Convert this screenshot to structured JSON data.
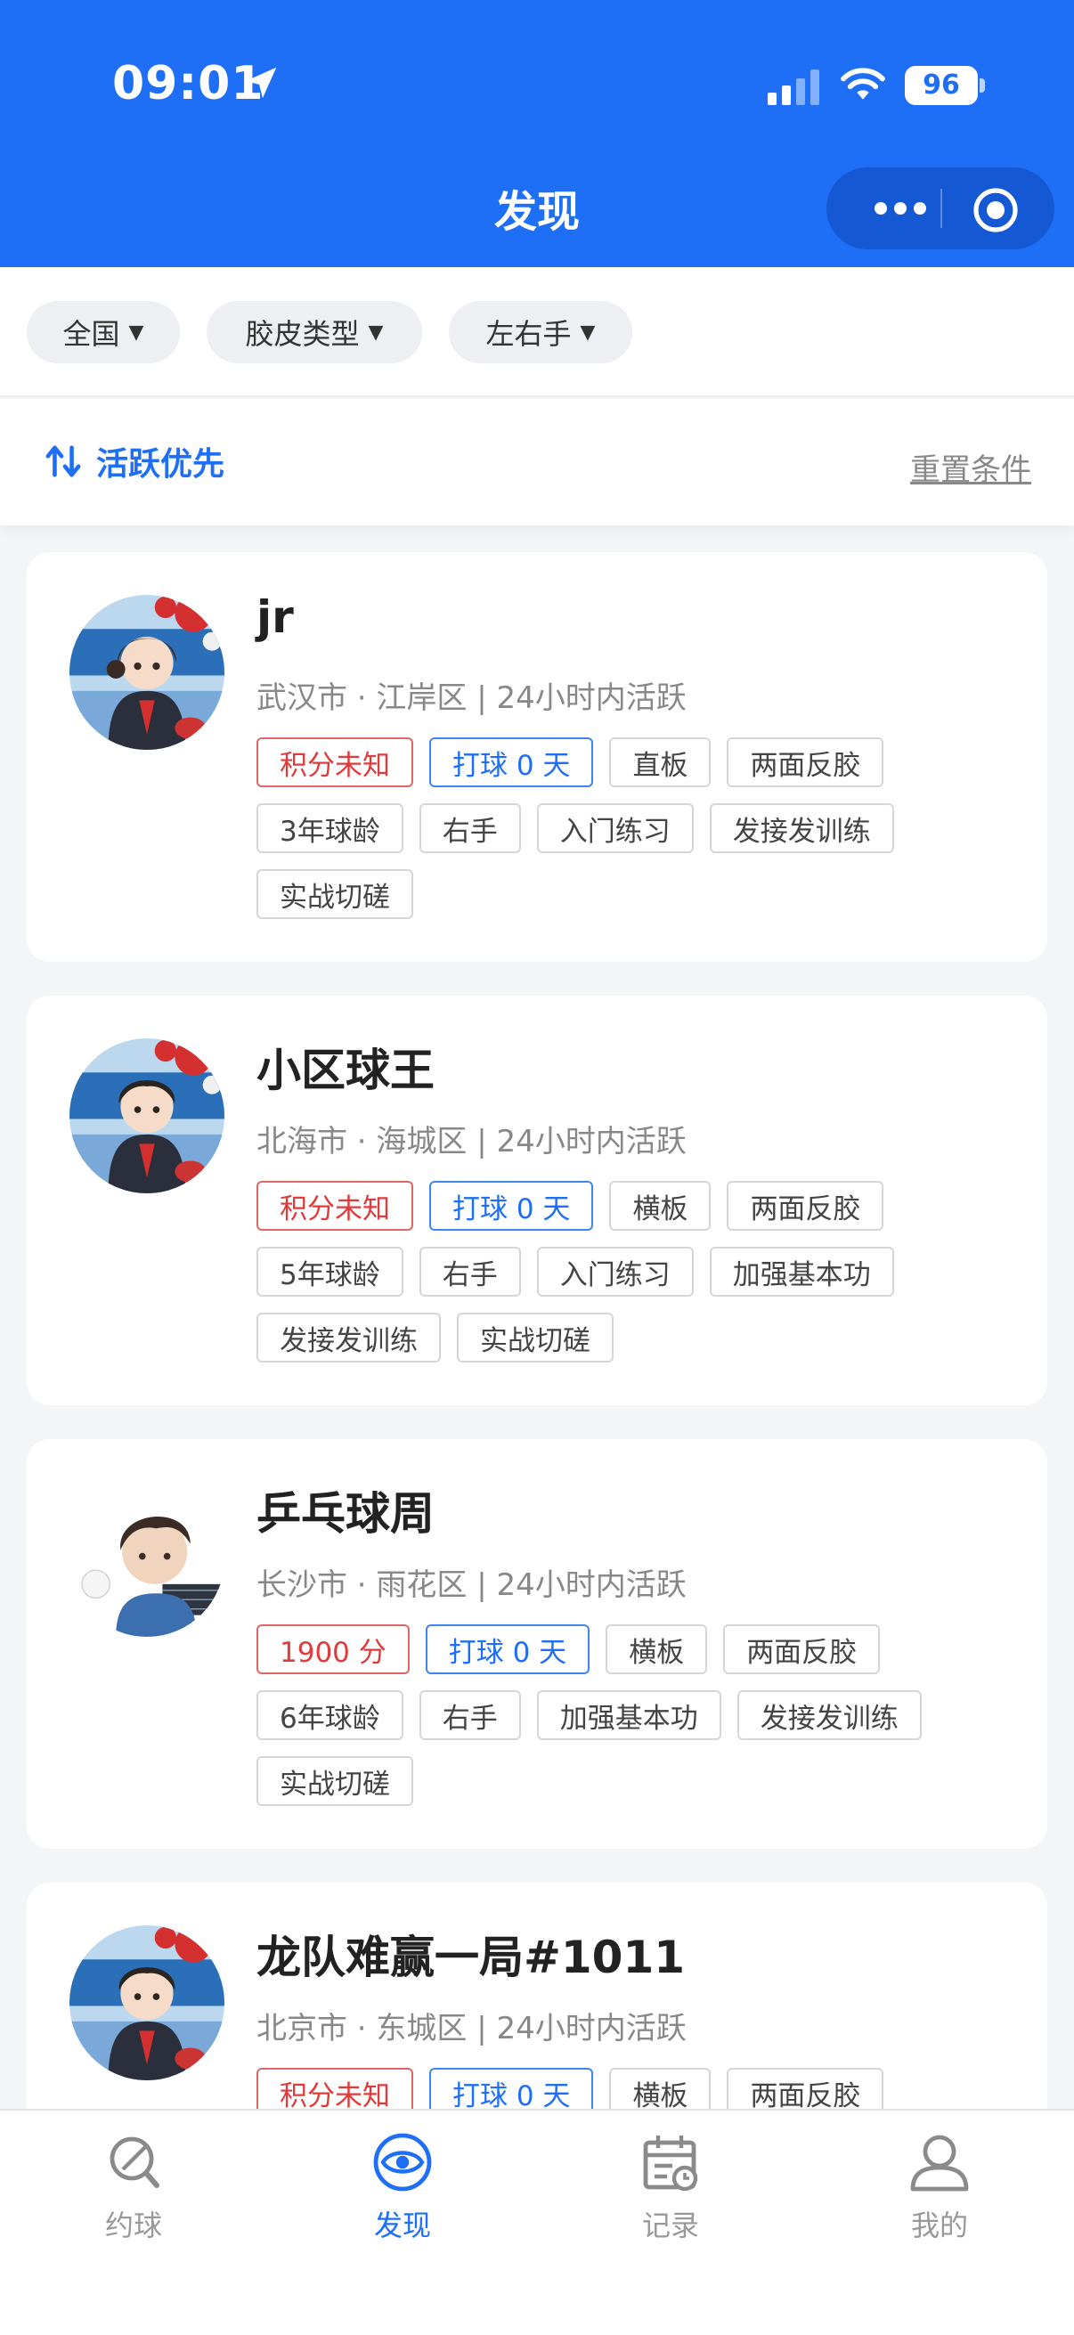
{
  "status_bar": {
    "time": "09:01",
    "battery": "96"
  },
  "header": {
    "title": "发现"
  },
  "filters": [
    {
      "label": "全国"
    },
    {
      "label": "胶皮类型"
    },
    {
      "label": "左右手"
    }
  ],
  "sort": {
    "label": "活跃优先",
    "reset": "重置条件"
  },
  "players": [
    {
      "name": "jr",
      "location": "武汉市 · 江岸区 | 24小时内活跃",
      "tags": [
        {
          "text": "积分未知",
          "style": "red"
        },
        {
          "text": "打球 0 天",
          "style": "blue"
        },
        {
          "text": "直板",
          "style": "gray"
        },
        {
          "text": "两面反胶",
          "style": "gray"
        },
        {
          "text": "3年球龄",
          "style": "gray"
        },
        {
          "text": "右手",
          "style": "gray"
        },
        {
          "text": "入门练习",
          "style": "gray"
        },
        {
          "text": "发接发训练",
          "style": "gray"
        },
        {
          "text": "实战切磋",
          "style": "gray"
        }
      ]
    },
    {
      "name": "小区球王",
      "location": "北海市 · 海城区 | 24小时内活跃",
      "tags": [
        {
          "text": "积分未知",
          "style": "red"
        },
        {
          "text": "打球 0 天",
          "style": "blue"
        },
        {
          "text": "横板",
          "style": "gray"
        },
        {
          "text": "两面反胶",
          "style": "gray"
        },
        {
          "text": "5年球龄",
          "style": "gray"
        },
        {
          "text": "右手",
          "style": "gray"
        },
        {
          "text": "入门练习",
          "style": "gray"
        },
        {
          "text": "加强基本功",
          "style": "gray"
        },
        {
          "text": "发接发训练",
          "style": "gray"
        },
        {
          "text": "实战切磋",
          "style": "gray"
        }
      ]
    },
    {
      "name": "乒乓球周",
      "location": "长沙市 · 雨花区 | 24小时内活跃",
      "tags": [
        {
          "text": "1900 分",
          "style": "red"
        },
        {
          "text": "打球 0 天",
          "style": "blue"
        },
        {
          "text": "横板",
          "style": "gray"
        },
        {
          "text": "两面反胶",
          "style": "gray"
        },
        {
          "text": "6年球龄",
          "style": "gray"
        },
        {
          "text": "右手",
          "style": "gray"
        },
        {
          "text": "加强基本功",
          "style": "gray"
        },
        {
          "text": "发接发训练",
          "style": "gray"
        },
        {
          "text": "实战切磋",
          "style": "gray"
        }
      ]
    },
    {
      "name": "龙队难赢一局#1011",
      "location": "北京市 · 东城区 | 24小时内活跃",
      "tags": [
        {
          "text": "积分未知",
          "style": "red"
        },
        {
          "text": "打球 0 天",
          "style": "blue"
        },
        {
          "text": "横板",
          "style": "gray"
        },
        {
          "text": "两面反胶",
          "style": "gray"
        }
      ]
    }
  ],
  "tabbar": [
    {
      "label": "约球",
      "icon": "racket-icon",
      "active": false
    },
    {
      "label": "发现",
      "icon": "eye-icon",
      "active": true
    },
    {
      "label": "记录",
      "icon": "calendar-icon",
      "active": false
    },
    {
      "label": "我的",
      "icon": "user-icon",
      "active": false
    }
  ],
  "colors": {
    "primary": "#1e6ff5",
    "tag_red": "#e03a3a",
    "page_bg": "#f4f5f7"
  }
}
